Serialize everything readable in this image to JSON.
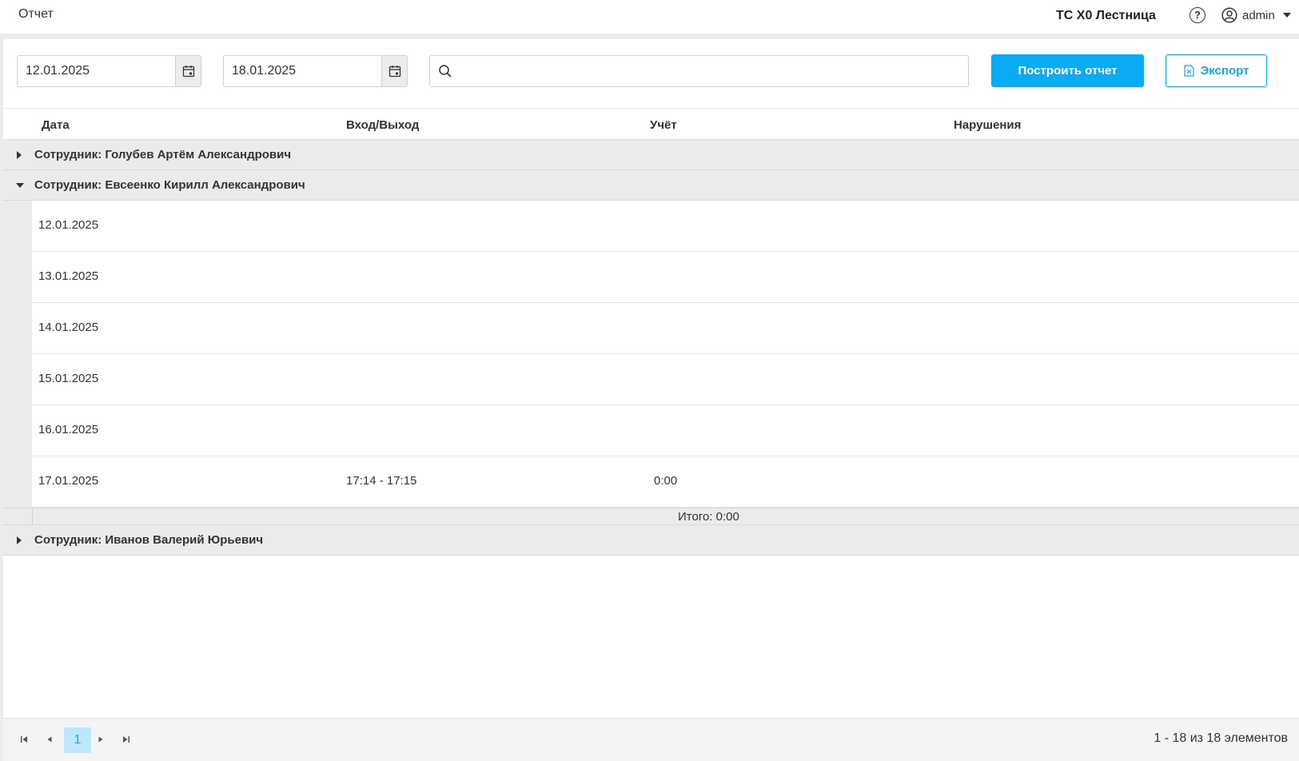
{
  "topbar": {
    "title": "Отчет",
    "org": "ТС Х0 Лестница",
    "user": "admin"
  },
  "filters": {
    "date_from": "12.01.2025",
    "date_to": "18.01.2025",
    "search_value": "",
    "build_label": "Построить отчет",
    "export_label": "Экспорт"
  },
  "grid": {
    "columns": [
      "Дата",
      "Вход/Выход",
      "Учёт",
      "Нарушения"
    ],
    "groups": [
      {
        "label": "Сотрудник: Голубев Артём Александрович",
        "expanded": false
      },
      {
        "label": "Сотрудник: Евсеенко Кирилл Александрович",
        "expanded": true,
        "rows": [
          {
            "date": "12.01.2025",
            "inout": "",
            "account": "",
            "violations": ""
          },
          {
            "date": "13.01.2025",
            "inout": "",
            "account": "",
            "violations": ""
          },
          {
            "date": "14.01.2025",
            "inout": "",
            "account": "",
            "violations": ""
          },
          {
            "date": "15.01.2025",
            "inout": "",
            "account": "",
            "violations": ""
          },
          {
            "date": "16.01.2025",
            "inout": "",
            "account": "",
            "violations": ""
          },
          {
            "date": "17.01.2025",
            "inout": "17:14 - 17:15",
            "account": "0:00",
            "violations": ""
          }
        ],
        "total": "Итого: 0:00"
      },
      {
        "label": "Сотрудник: Иванов Валерий Юрьевич",
        "expanded": false
      }
    ]
  },
  "pager": {
    "current_page": "1",
    "info": "1 - 18 из 18 элементов"
  },
  "colors": {
    "accent": "#0aabf2",
    "group_bg": "#ebebeb"
  }
}
